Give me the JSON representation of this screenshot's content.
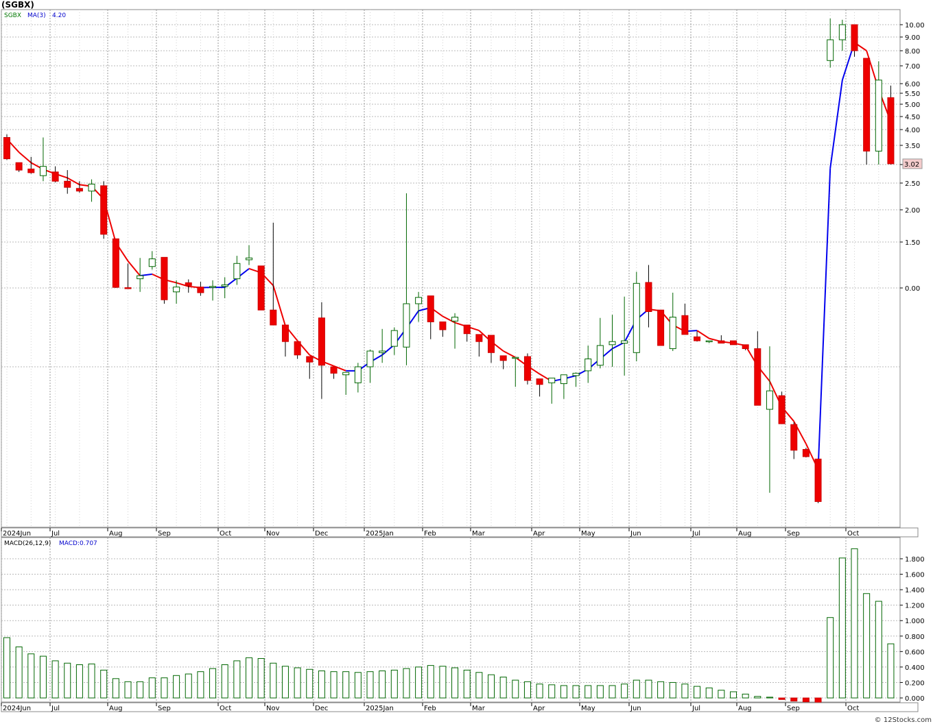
{
  "chart": {
    "title": "(SGBX)"
  },
  "footer": "© 12Stocks.com",
  "chart_data": [
    {
      "type": "candlestick",
      "title": "(SGBX)",
      "legend": [
        "SGBX",
        "MA(3)",
        "4.20"
      ],
      "colors": {
        "up": "#007700",
        "down": "#ee0000",
        "ma_up": "#0000ee",
        "ma_down": "#ee0000",
        "last_bg": "#f4cccc"
      },
      "last_price": "3.02",
      "y_ticks": [
        "10.00",
        "9.00",
        "8.00",
        "7.00",
        "6.00",
        "5.50",
        "5.00",
        "4.50",
        "4.00",
        "3.50",
        "3.00",
        "2.50",
        "2.00",
        "1.50",
        "0.00"
      ],
      "x_labels": [
        "2024Jun",
        "Jul",
        "Aug",
        "Sep",
        "Oct",
        "Nov",
        "Dec",
        "2025Jan",
        "Feb",
        "Mar",
        "Apr",
        "May",
        "Jun",
        "Jul",
        "Aug",
        "Sep",
        "Oct"
      ],
      "candles": [
        {
          "o": 3.75,
          "h": 3.85,
          "l": 3.12,
          "c": 3.15
        },
        {
          "o": 3.05,
          "h": 3.05,
          "l": 2.8,
          "c": 2.85
        },
        {
          "o": 2.88,
          "h": 3.2,
          "l": 2.75,
          "c": 2.78
        },
        {
          "o": 2.7,
          "h": 3.75,
          "l": 2.55,
          "c": 2.95
        },
        {
          "o": 2.8,
          "h": 2.95,
          "l": 2.52,
          "c": 2.55
        },
        {
          "o": 2.55,
          "h": 2.85,
          "l": 2.3,
          "c": 2.42
        },
        {
          "o": 2.4,
          "h": 2.55,
          "l": 2.32,
          "c": 2.35
        },
        {
          "o": 2.35,
          "h": 2.6,
          "l": 2.15,
          "c": 2.48
        },
        {
          "o": 2.45,
          "h": 2.55,
          "l": 1.55,
          "c": 1.62
        },
        {
          "o": 1.55,
          "h": 1.55,
          "l": 0.0,
          "c": 0.02
        },
        {
          "o": 0.01,
          "h": 0.8,
          "l": 0.0,
          "c": 0.0
        },
        {
          "o": 0.3,
          "h": 0.98,
          "l": -0.05,
          "c": 0.4
        },
        {
          "o": 0.7,
          "h": 1.2,
          "l": 0.6,
          "c": 0.95
        },
        {
          "o": 1.0,
          "h": 1.0,
          "l": -0.2,
          "c": -0.15
        },
        {
          "o": -0.05,
          "h": 0.25,
          "l": -0.2,
          "c": 0.03
        },
        {
          "o": 0.17,
          "h": 0.28,
          "l": -0.06,
          "c": 0.08
        },
        {
          "o": 0.03,
          "h": 0.2,
          "l": -0.1,
          "c": -0.06
        },
        {
          "o": 0.03,
          "h": 0.25,
          "l": -0.16,
          "c": 0.05
        },
        {
          "o": 0.05,
          "h": 0.35,
          "l": -0.13,
          "c": 0.1
        },
        {
          "o": 0.3,
          "h": 1.05,
          "l": 0.1,
          "c": 0.8
        },
        {
          "o": 0.92,
          "h": 1.4,
          "l": 0.75,
          "c": 0.98
        },
        {
          "o": 0.72,
          "h": 0.72,
          "l": -0.28,
          "c": -0.28
        },
        {
          "o": -0.28,
          "h": 1.8,
          "l": -0.42,
          "c": -0.47
        },
        {
          "o": -0.47,
          "h": -0.47,
          "l": -0.87,
          "c": -0.68
        },
        {
          "o": -0.68,
          "h": -0.68,
          "l": -0.9,
          "c": -0.85
        },
        {
          "o": -0.87,
          "h": -0.87,
          "l": -1.15,
          "c": -0.94
        },
        {
          "o": -0.38,
          "h": -0.18,
          "l": -1.4,
          "c": -0.98
        },
        {
          "o": -1.0,
          "h": -1.0,
          "l": -1.15,
          "c": -1.08
        },
        {
          "o": -1.1,
          "h": -1.1,
          "l": -1.35,
          "c": -1.07
        },
        {
          "o": -1.2,
          "h": -0.95,
          "l": -1.32,
          "c": -1.0
        },
        {
          "o": -1.0,
          "h": -0.78,
          "l": -1.2,
          "c": -0.8
        },
        {
          "o": -0.82,
          "h": -0.52,
          "l": -0.95,
          "c": -0.8
        },
        {
          "o": -0.74,
          "h": -0.5,
          "l": -0.85,
          "c": -0.54
        },
        {
          "o": -0.75,
          "h": 2.31,
          "l": -0.98,
          "c": -0.2
        },
        {
          "o": -0.2,
          "h": -0.05,
          "l": -0.43,
          "c": -0.12
        },
        {
          "o": -0.1,
          "h": -0.1,
          "l": -0.65,
          "c": -0.43
        },
        {
          "o": -0.43,
          "h": -0.43,
          "l": -0.62,
          "c": -0.53
        },
        {
          "o": -0.42,
          "h": -0.32,
          "l": -0.77,
          "c": -0.37
        },
        {
          "o": -0.47,
          "h": -0.47,
          "l": -0.68,
          "c": -0.58
        },
        {
          "o": -0.59,
          "h": -0.59,
          "l": -0.87,
          "c": -0.68
        },
        {
          "o": -0.6,
          "h": -0.63,
          "l": -0.95,
          "c": -0.82
        },
        {
          "o": -0.86,
          "h": -0.86,
          "l": -1.03,
          "c": -0.92
        },
        {
          "o": -0.88,
          "h": -0.88,
          "l": -1.25,
          "c": -0.88
        },
        {
          "o": -0.87,
          "h": -0.83,
          "l": -1.22,
          "c": -1.17
        },
        {
          "o": -1.15,
          "h": -1.15,
          "l": -1.37,
          "c": -1.22
        },
        {
          "o": -1.2,
          "h": -1.14,
          "l": -1.46,
          "c": -1.14
        },
        {
          "o": -1.21,
          "h": -1.1,
          "l": -1.4,
          "c": -1.1
        },
        {
          "o": -1.11,
          "h": -1.07,
          "l": -1.25,
          "c": -1.08
        },
        {
          "o": -1.05,
          "h": -0.73,
          "l": -1.2,
          "c": -0.9
        },
        {
          "o": -0.98,
          "h": -0.38,
          "l": -1.02,
          "c": -0.73
        },
        {
          "o": -0.72,
          "h": -0.34,
          "l": -1.0,
          "c": -0.68
        },
        {
          "o": -0.7,
          "h": -0.11,
          "l": -1.11,
          "c": -0.67
        },
        {
          "o": -0.82,
          "h": 0.53,
          "l": -0.93,
          "c": 0.15
        },
        {
          "o": 0.18,
          "h": 0.75,
          "l": -0.5,
          "c": -0.3
        },
        {
          "o": -0.28,
          "h": -0.28,
          "l": -0.73,
          "c": -0.73
        },
        {
          "o": -0.77,
          "h": -0.06,
          "l": -0.8,
          "c": -0.37
        },
        {
          "o": -0.35,
          "h": -0.2,
          "l": -0.5,
          "c": -0.59
        },
        {
          "o": -0.62,
          "h": -0.55,
          "l": -0.68,
          "c": -0.67
        },
        {
          "o": -0.67,
          "h": -0.67,
          "l": -0.7,
          "c": -0.67
        },
        {
          "o": -0.67,
          "h": -0.6,
          "l": -0.7,
          "c": -0.7
        },
        {
          "o": -0.67,
          "h": -0.67,
          "l": -0.72,
          "c": -0.72
        },
        {
          "o": -0.72,
          "h": -0.73,
          "l": -0.79,
          "c": -0.77
        },
        {
          "o": -0.77,
          "h": -0.55,
          "l": -0.8,
          "c": -1.48
        },
        {
          "o": -1.53,
          "h": -0.74,
          "l": -2.57,
          "c": -1.3
        },
        {
          "o": -1.36,
          "h": -1.31,
          "l": -1.71,
          "c": -1.71
        },
        {
          "o": -1.72,
          "h": -1.69,
          "l": -2.15,
          "c": -2.04
        },
        {
          "o": -2.03,
          "h": -2.01,
          "l": -2.13,
          "c": -2.12
        },
        {
          "o": -2.15,
          "h": -2.15,
          "l": -2.7,
          "c": -2.68
        },
        {
          "o": 7.35,
          "h": 10.5,
          "l": 6.9,
          "c": 8.8
        },
        {
          "o": 8.8,
          "h": 10.4,
          "l": 8.0,
          "c": 10.0
        },
        {
          "o": 10.0,
          "h": 10.0,
          "l": 7.6,
          "c": 8.0
        },
        {
          "o": 7.5,
          "h": 7.5,
          "l": 3.0,
          "c": 3.35
        },
        {
          "o": 3.35,
          "h": 7.3,
          "l": 3.0,
          "c": 6.2
        },
        {
          "o": 5.3,
          "h": 5.9,
          "l": 3.0,
          "c": 3.02
        }
      ],
      "ma3": [
        3.7,
        3.32,
        3.05,
        2.87,
        2.75,
        2.64,
        2.47,
        2.44,
        2.2,
        1.48,
        0.88,
        0.4,
        0.45,
        0.27,
        0.17,
        0.05,
        0.01,
        0.02,
        0.02,
        0.32,
        0.63,
        0.5,
        0.08,
        -0.48,
        -0.67,
        -0.85,
        -0.93,
        -0.99,
        -1.05,
        -1.05,
        -0.94,
        -0.85,
        -0.72,
        -0.51,
        -0.29,
        -0.25,
        -0.36,
        -0.44,
        -0.49,
        -0.54,
        -0.68,
        -0.8,
        -0.88,
        -0.99,
        -1.09,
        -1.18,
        -1.15,
        -1.11,
        -1.03,
        -0.9,
        -0.77,
        -0.69,
        -0.4,
        -0.27,
        -0.29,
        -0.47,
        -0.55,
        -0.54,
        -0.64,
        -0.68,
        -0.7,
        -0.73,
        -0.99,
        -1.18,
        -1.5,
        -1.68,
        -1.96,
        -2.28,
        2.9,
        6.2,
        8.6,
        8.0,
        5.7,
        4.3
      ]
    },
    {
      "type": "bar",
      "title": "MACD(26,12,9)",
      "legend": [
        "MACD(26,12,9)",
        "MACD:0.707"
      ],
      "y_ticks": [
        "1.800",
        "1.600",
        "1.400",
        "1.200",
        "1.000",
        "0.800",
        "0.600",
        "0.400",
        "0.200",
        "0.000"
      ],
      "ylim": [
        0,
        2.0
      ],
      "x_labels": [
        "2024Jun",
        "Jul",
        "Aug",
        "Sep",
        "Oct",
        "Nov",
        "Dec",
        "2025Jan",
        "Feb",
        "Mar",
        "Apr",
        "May",
        "Jun",
        "Jul",
        "Aug",
        "Sep",
        "Oct"
      ],
      "values": [
        0.78,
        0.66,
        0.57,
        0.54,
        0.48,
        0.45,
        0.43,
        0.44,
        0.36,
        0.25,
        0.21,
        0.21,
        0.26,
        0.26,
        0.29,
        0.31,
        0.34,
        0.38,
        0.43,
        0.48,
        0.52,
        0.51,
        0.45,
        0.41,
        0.39,
        0.37,
        0.35,
        0.34,
        0.34,
        0.33,
        0.34,
        0.35,
        0.36,
        0.38,
        0.4,
        0.42,
        0.41,
        0.39,
        0.36,
        0.33,
        0.3,
        0.27,
        0.23,
        0.21,
        0.18,
        0.17,
        0.16,
        0.16,
        0.16,
        0.16,
        0.16,
        0.18,
        0.23,
        0.23,
        0.21,
        0.2,
        0.18,
        0.15,
        0.13,
        0.1,
        0.08,
        0.05,
        0.02,
        0.01,
        -0.02,
        -0.04,
        -0.05,
        -0.07,
        1.04,
        1.81,
        1.93,
        1.35,
        1.25,
        0.7
      ]
    }
  ]
}
